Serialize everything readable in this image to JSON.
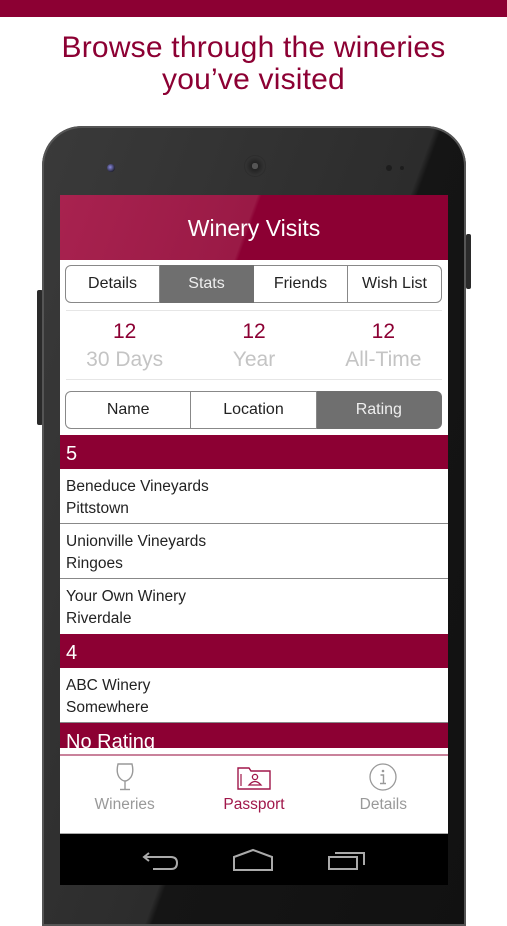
{
  "promo": {
    "headline_line1": "Browse through the wineries",
    "headline_line2": "you’ve visited",
    "accent_color": "#8c0033"
  },
  "app": {
    "title": "Winery Visits",
    "top_tabs": [
      {
        "label": "Details",
        "active": false
      },
      {
        "label": "Stats",
        "active": true
      },
      {
        "label": "Friends",
        "active": false
      },
      {
        "label": "Wish List",
        "active": false
      }
    ],
    "stats": [
      {
        "value": "12",
        "label": "30 Days"
      },
      {
        "value": "12",
        "label": "Year"
      },
      {
        "value": "12",
        "label": "All-Time"
      }
    ],
    "sort_tabs": [
      {
        "label": "Name",
        "active": false
      },
      {
        "label": "Location",
        "active": false
      },
      {
        "label": "Rating",
        "active": true
      }
    ],
    "groups": [
      {
        "header": "5",
        "items": [
          {
            "name": "Beneduce Vineyards",
            "location": "Pittstown"
          },
          {
            "name": "Unionville Vineyards",
            "location": "Ringoes"
          },
          {
            "name": "Your Own Winery",
            "location": "Riverdale"
          }
        ]
      },
      {
        "header": "4",
        "items": [
          {
            "name": "ABC Winery",
            "location": "Somewhere"
          }
        ]
      },
      {
        "header": "No Rating",
        "items": []
      }
    ],
    "bottom_tabs": [
      {
        "label": "Wineries",
        "icon": "wine-glass-icon",
        "active": false
      },
      {
        "label": "Passport",
        "icon": "passport-folder-icon",
        "active": true
      },
      {
        "label": "Details",
        "icon": "info-icon",
        "active": false
      }
    ],
    "nav_buttons": [
      "back-icon",
      "home-icon",
      "recents-icon"
    ]
  }
}
